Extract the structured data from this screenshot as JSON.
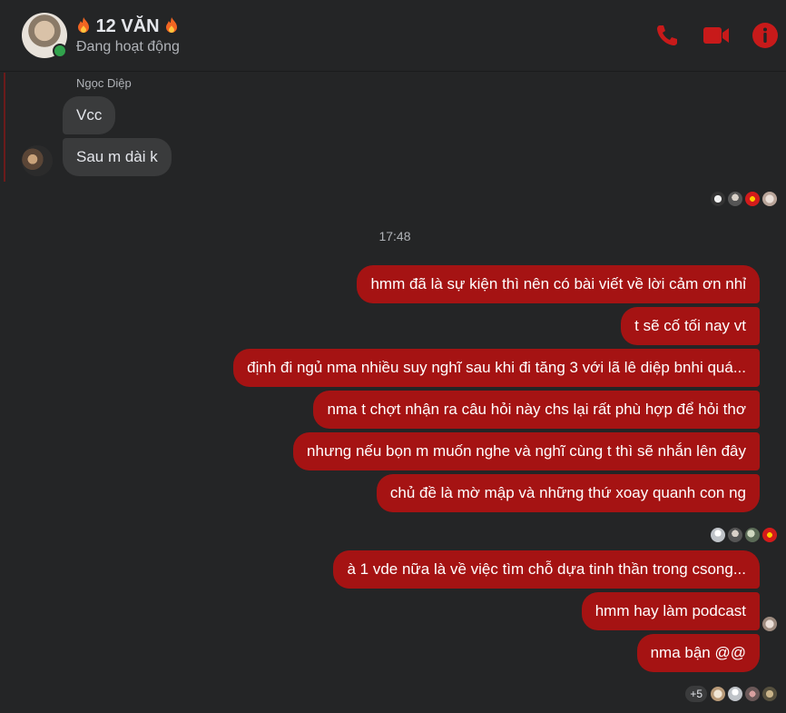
{
  "header": {
    "title": "12 VĂN",
    "status": "Đang hoạt động"
  },
  "colors": {
    "background": "#242526",
    "incoming_bubble": "#3a3b3c",
    "outgoing_bubble": "#a51313",
    "accent": "#c81a1a",
    "online": "#31a24c"
  },
  "incoming": {
    "sender": "Ngọc Diệp",
    "messages": [
      "Vcc",
      "Sau m dài k"
    ]
  },
  "timestamp": "17:48",
  "outgoing": {
    "messages": [
      "hmm đã là sự kiện thì nên có bài viết về lời cảm ơn nhỉ",
      "t sẽ cố tối nay vt",
      "định đi ngủ nma nhiều suy nghĩ sau khi đi tăng 3 với lã lê diệp bnhi quá...",
      "nma t chợt nhận ra câu hỏi này chs lại rất phù hợp để hỏi thơ",
      "nhưng nếu bọn m muốn nghe và nghĩ cùng t thì sẽ nhắn lên đây",
      "chủ đề là mờ mập và những thứ xoay quanh con ng",
      "à 1 vde nữa là về việc tìm chỗ dựa tinh thần trong csong...",
      "hmm hay làm podcast",
      "nma bận @@"
    ]
  },
  "seen_extra": "+5",
  "icons": {
    "call": "phone-icon",
    "video": "video-camera-icon",
    "info": "info-icon",
    "title_decoration": "fire-icon"
  }
}
